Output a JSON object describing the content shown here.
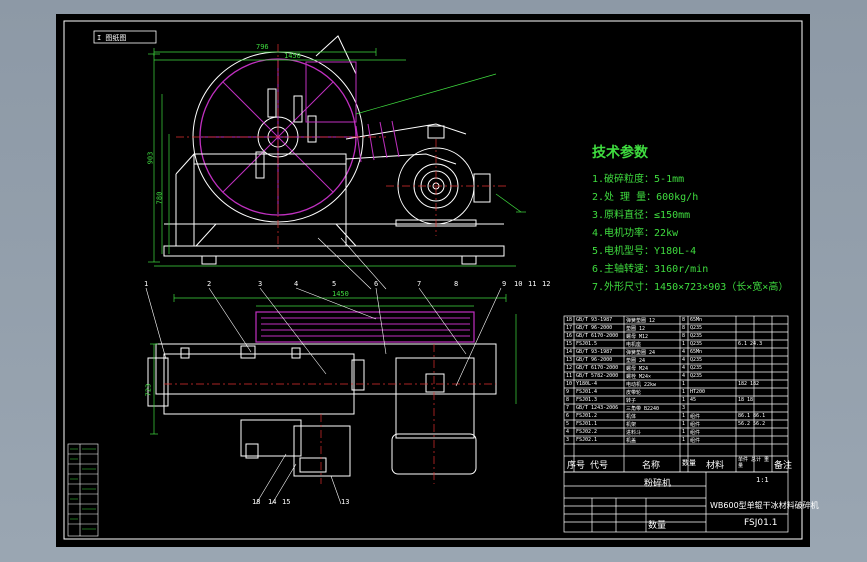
{
  "frame_tag": "I 图纸图",
  "tech": {
    "title": "技术参数",
    "items": [
      "1.破碎粒度：5-1mm",
      "2.处 理 量：600kg/h",
      "3.原料直径：≤150mm",
      "4.电机功率：22kw",
      "5.电机型号：Y180L-4",
      "6.主轴转速：3160r/min",
      "7.外形尺寸：1450×723×903（长×宽×高）"
    ]
  },
  "colors": {
    "sheet": "#000000",
    "outline": "#ffffff",
    "dimension": "#3fdc3f",
    "section": "#c030c0",
    "centerline": "#e03030"
  },
  "bom_header": {
    "no": "序号",
    "code": "代号",
    "name": "名称",
    "qty": "数量",
    "material": "材料",
    "weight": "单件 总计 重量",
    "note": "备注"
  },
  "bom_rows": [
    {
      "no": "18",
      "code": "GB/T 93-1987",
      "name": "弹簧垫圈 12",
      "qty": "8",
      "mat": "65Mn"
    },
    {
      "no": "17",
      "code": "GB/T 96-2000",
      "name": "垫圈 12",
      "qty": "8",
      "mat": "Q235"
    },
    {
      "no": "16",
      "code": "GB/T 6170-2000",
      "name": "螺母 M12",
      "qty": "8",
      "mat": "Q235"
    },
    {
      "no": "15",
      "code": "FSJ01.5",
      "name": "电机座",
      "qty": "1",
      "mat": "Q235",
      "w": "6.1 24.3"
    },
    {
      "no": "14",
      "code": "GB/T 93-1987",
      "name": "弹簧垫圈 24",
      "qty": "4",
      "mat": "65Mn"
    },
    {
      "no": "13",
      "code": "GB/T 96-2000",
      "name": "垫圈 24",
      "qty": "4",
      "mat": "Q235"
    },
    {
      "no": "12",
      "code": "GB/T 6170-2000",
      "name": "螺母 M24",
      "qty": "4",
      "mat": "Q235"
    },
    {
      "no": "11",
      "code": "GB/T 5782-2000",
      "name": "螺栓 M24×",
      "qty": "4",
      "mat": "Q235"
    },
    {
      "no": "10",
      "code": "Y180L-4",
      "name": "电动机 22kw",
      "qty": "1",
      "mat": "",
      "w": "182 182"
    },
    {
      "no": "9",
      "code": "FSJ01.4",
      "name": "皮带轮",
      "qty": "1",
      "mat": "HT200"
    },
    {
      "no": "8",
      "code": "FSJ01.3",
      "name": "转子",
      "qty": "1",
      "mat": "45",
      "w": "18 18"
    },
    {
      "no": "7",
      "code": "GB/T 1243-2006",
      "name": "三角带 B2240",
      "qty": "3",
      "mat": ""
    },
    {
      "no": "6",
      "code": "FSJ01.2",
      "name": "机体",
      "qty": "1",
      "mat": "组件",
      "w": "86.1 86.1"
    },
    {
      "no": "5",
      "code": "FSJ01.1",
      "name": "机架",
      "qty": "1",
      "mat": "组件",
      "w": "56.2 56.2"
    },
    {
      "no": "4",
      "code": "FSJ02.2",
      "name": "进料斗",
      "qty": "1",
      "mat": "组件"
    },
    {
      "no": "3",
      "code": "FSJ02.1",
      "name": "机盖",
      "qty": "1",
      "mat": "组件"
    }
  ],
  "title_block": {
    "drawing_name": "粉碎机",
    "product": "WB600型单辊干冰材料破碎机",
    "drawing_no": "FSJ01.1",
    "scale": "1:1",
    "material_label": "数量"
  },
  "part_tags_top": [
    "1",
    "2",
    "3",
    "4",
    "5",
    "6",
    "7",
    "8",
    "9",
    "10",
    "11",
    "12"
  ],
  "part_tags_bottom": [
    "18",
    "14",
    "15",
    "13"
  ],
  "dims": {
    "top_width": "796",
    "top_width2": "1450",
    "height": "903",
    "height2": "780",
    "plan_width": "1450",
    "plan_depth": "723"
  }
}
